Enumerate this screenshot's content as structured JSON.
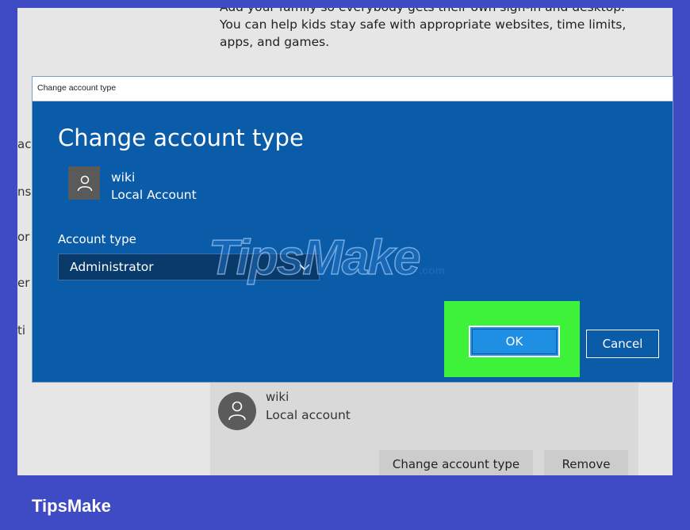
{
  "background": {
    "intro_lines": [
      "Add your family so everybody gets their own sign-in and desktop.",
      "You can help kids stay safe with appropriate websites, time limits,",
      "apps, and games."
    ],
    "sidebar_fragments": [
      "ac",
      "ns",
      "or",
      "er",
      "ti"
    ],
    "member_card": {
      "name": "wiki",
      "type": "Local account",
      "change_button": "Change account type",
      "remove_button": "Remove"
    }
  },
  "dialog": {
    "window_title": "Change account type",
    "heading": "Change account type",
    "user_name": "wiki",
    "user_type": "Local Account",
    "account_type_label": "Account type",
    "account_type_value": "Administrator",
    "ok_label": "OK",
    "cancel_label": "Cancel"
  },
  "watermark": {
    "main": "TipsMake",
    "suffix": ".com"
  },
  "footer_brand": "TipsMake",
  "colors": {
    "frame": "#3f4bc4",
    "dialog": "#0a5ba8",
    "highlight": "#3ef23a",
    "ok_button": "#1f8fe4"
  },
  "icons": {
    "user_avatar": "person-icon",
    "dropdown": "chevron-down-icon"
  }
}
